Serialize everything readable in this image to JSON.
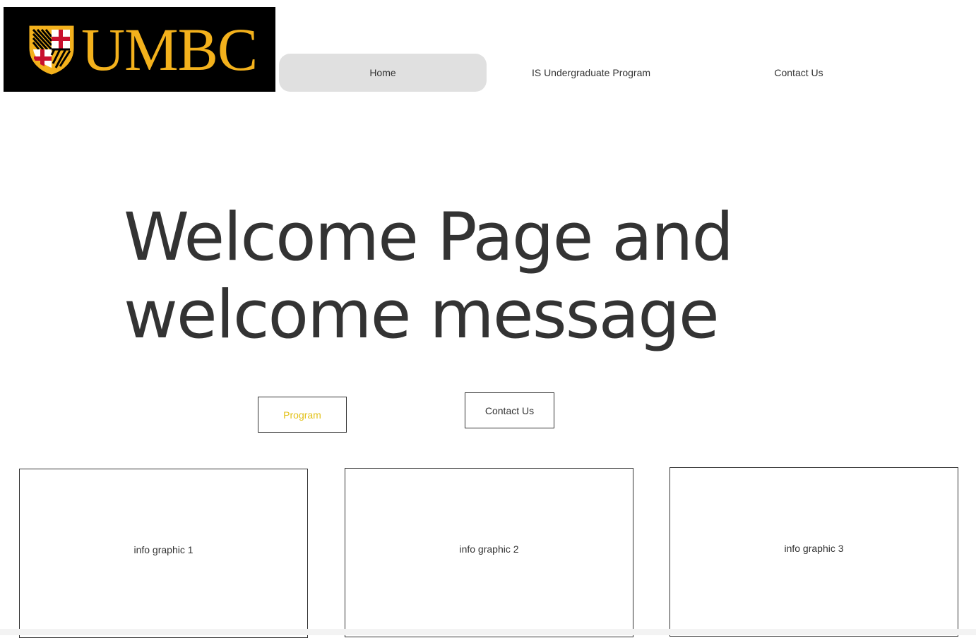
{
  "header": {
    "logo_text": "UMBC",
    "nav": [
      {
        "label": "Home",
        "active": true
      },
      {
        "label": "IS Undergraduate Program",
        "active": false
      },
      {
        "label": "Contact Us",
        "active": false
      }
    ]
  },
  "hero": {
    "title_line1": "Welcome Page and",
    "title_line2": "welcome message"
  },
  "actions": {
    "program_label": "Program",
    "contact_label": "Contact Us"
  },
  "info_graphics": [
    {
      "label": "info graphic 1"
    },
    {
      "label": "info graphic 2"
    },
    {
      "label": "info graphic 3"
    }
  ],
  "colors": {
    "brand_gold": "#f3b11c",
    "program_text": "#e3c21a",
    "nav_active_bg": "#e0e0e0",
    "logo_bg": "#000000"
  }
}
